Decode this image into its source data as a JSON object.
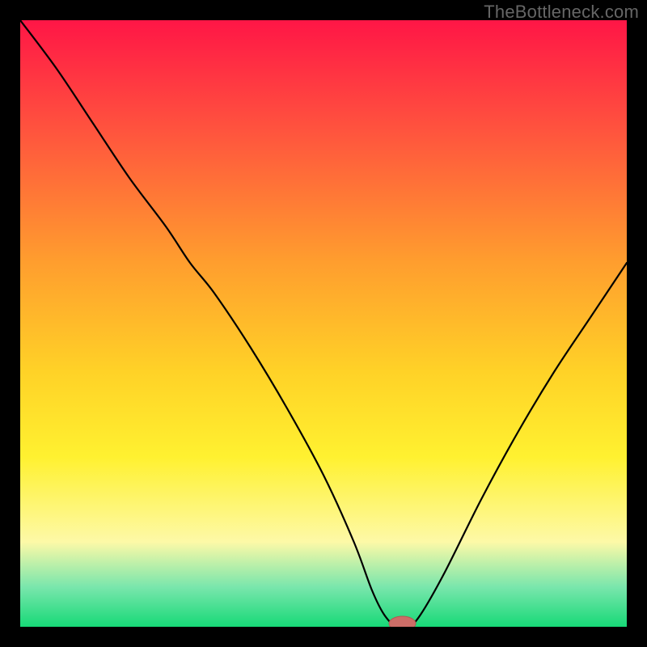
{
  "watermark": "TheBottleneck.com",
  "colors": {
    "page_bg": "#000000",
    "watermark": "#666666",
    "curve": "#000000",
    "marker_fill": "#cc6d67",
    "marker_stroke": "#b35752",
    "grad_top": "#ff1646",
    "grad_mid1": "#ff533e",
    "grad_mid2": "#ff9e2e",
    "grad_mid3": "#ffd227",
    "grad_mid4": "#fff130",
    "grad_lightband": "#fdf9a7",
    "grad_mint": "#78e6ac",
    "grad_green": "#17d977"
  },
  "chart_data": {
    "type": "line",
    "title": "",
    "xlabel": "",
    "ylabel": "",
    "xlim": [
      0,
      100
    ],
    "ylim": [
      0,
      100
    ],
    "series": [
      {
        "name": "bottleneck-curve",
        "x": [
          0,
          6,
          12,
          18,
          24,
          28,
          32,
          38,
          44,
          50,
          55,
          58,
          60,
          62,
          64,
          66,
          70,
          76,
          82,
          88,
          94,
          100
        ],
        "y": [
          100,
          92,
          83,
          74,
          66,
          60,
          55,
          46,
          36,
          25,
          14,
          6,
          2,
          0,
          0,
          2,
          9,
          21,
          32,
          42,
          51,
          60
        ]
      }
    ],
    "marker": {
      "x": 63,
      "y": 0,
      "rx": 2.2,
      "ry": 1.2
    },
    "background_gradient_stops": [
      {
        "offset": 0.0,
        "color": "#ff1646"
      },
      {
        "offset": 0.18,
        "color": "#ff533e"
      },
      {
        "offset": 0.4,
        "color": "#ff9e2e"
      },
      {
        "offset": 0.58,
        "color": "#ffd227"
      },
      {
        "offset": 0.72,
        "color": "#fff130"
      },
      {
        "offset": 0.86,
        "color": "#fdf9a7"
      },
      {
        "offset": 0.935,
        "color": "#78e6ac"
      },
      {
        "offset": 1.0,
        "color": "#17d977"
      }
    ]
  }
}
